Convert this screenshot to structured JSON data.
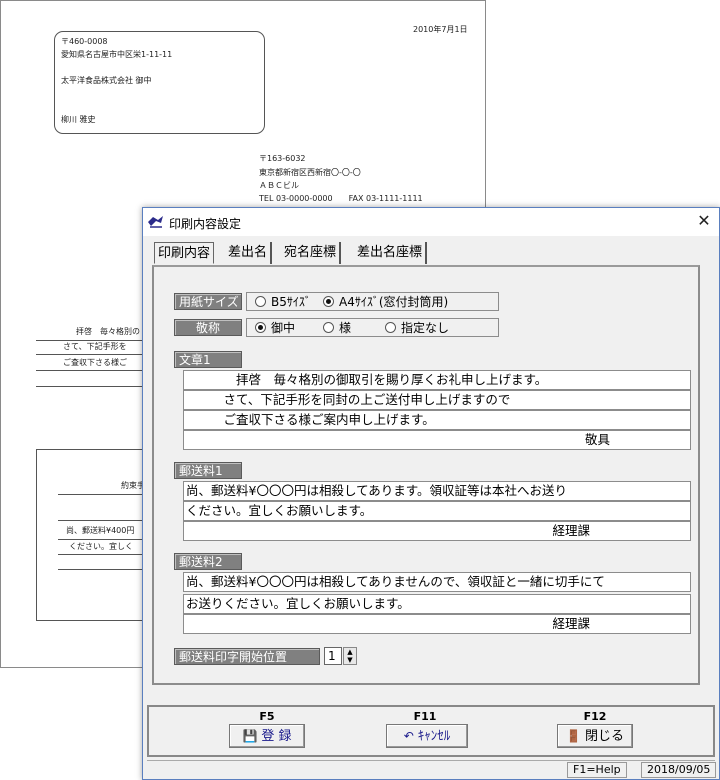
{
  "document": {
    "date": "2010年7月1日",
    "recipient": {
      "postal": "〒460-0008",
      "address": "愛知県名古屋市中区栄1-11-11",
      "company": "太平洋食品株式会社 御中",
      "person": "柳川 雅史"
    },
    "sender": {
      "postal": "〒163-6032",
      "address": "東京都新宿区西新宿〇-〇-〇",
      "building": "ＡＢＣビル",
      "phone": "TEL 03-0000-0000　　FAX 03-1111-1111"
    },
    "body_lines": [
      "拝啓　毎々格別の",
      "さて、下記手形を",
      "ご査収下さる様ご"
    ],
    "lower_lines": [
      "約束手",
      "尚、郵送料¥400円",
      "ください。宜しく"
    ]
  },
  "dialog": {
    "title": "印刷内容設定",
    "close_icon": "close-icon",
    "tabs": [
      "印刷内容",
      "差出名",
      "宛名座標",
      "差出名座標"
    ],
    "active_tab": 0,
    "paper_size": {
      "label": "用紙サイズ",
      "options": [
        "B5ｻｲｽﾞ",
        "A4ｻｲｽﾞ(窓付封筒用)"
      ],
      "selected": 1
    },
    "honorific": {
      "label": "敬称",
      "options": [
        "御中",
        "様",
        "指定なし"
      ],
      "selected": 0
    },
    "sentence1": {
      "label": "文章1",
      "lines": [
        "　　　　拝啓　毎々格別の御取引を賜り厚くお礼申し上げます。",
        "　　　さて、下記手形を同封の上ご送付申し上げますので",
        "　　　ご査収下さる様ご案内申し上げます。",
        "敬具"
      ]
    },
    "postage1": {
      "label": "郵送料1",
      "lines": [
        "尚、郵送料¥〇〇〇円は相殺してあります。領収証等は本社へお送り",
        "ください。宜しくお願いします。",
        "経理課"
      ]
    },
    "postage2": {
      "label": "郵送料2",
      "lines": [
        "尚、郵送料¥〇〇〇円は相殺してありませんので、領収証と一緒に切手にて",
        "お送りください。宜しくお願いします。",
        "経理課"
      ]
    },
    "postage_start": {
      "label": "郵送料印字開始位置",
      "value": "1"
    },
    "footer": {
      "buttons": [
        {
          "key": "F5",
          "label": "登 録",
          "icon": "floppy-disk-icon"
        },
        {
          "key": "F11",
          "label": "ｷｬﾝｾﾙ",
          "icon": "undo-arrow-icon"
        },
        {
          "key": "F12",
          "label": "閉じる",
          "icon": "exit-door-icon"
        }
      ]
    },
    "status": {
      "help": "F1=Help",
      "date": "2018/09/05"
    },
    "colors": {
      "group_label_bg": "#808080",
      "save_label": "#1a1a8c",
      "cancel_label": "#1a1a8c"
    }
  }
}
